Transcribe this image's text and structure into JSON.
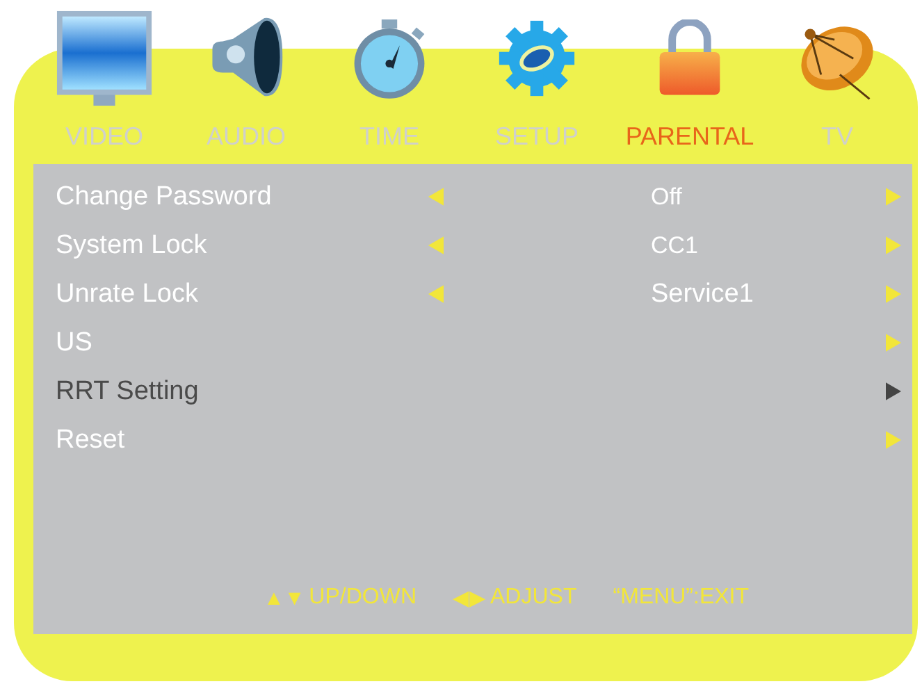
{
  "tabs": [
    {
      "kind": "monitor",
      "label": "VIDEO",
      "selected": false
    },
    {
      "kind": "speaker",
      "label": "AUDIO",
      "selected": false
    },
    {
      "kind": "stopwatch",
      "label": "TIME",
      "selected": false
    },
    {
      "kind": "gear",
      "label": "SETUP",
      "selected": false
    },
    {
      "kind": "padlock",
      "label": "PARENTAL",
      "selected": true
    },
    {
      "kind": "dish",
      "label": "TV",
      "selected": false
    }
  ],
  "rows": [
    {
      "label": "Change Password",
      "adjustable": true,
      "value": "Off",
      "value_disabled": true,
      "selected": false
    },
    {
      "label": "System Lock",
      "adjustable": true,
      "value": "CC1",
      "value_disabled": true,
      "selected": false
    },
    {
      "label": "Unrate Lock",
      "adjustable": true,
      "value": "Service1",
      "value_disabled": false,
      "selected": false
    },
    {
      "label": "US",
      "adjustable": false,
      "selected": false
    },
    {
      "label": "RRT Setting",
      "adjustable": false,
      "selected": true
    },
    {
      "label": "Reset",
      "adjustable": false,
      "selected": false
    }
  ],
  "hints": [
    {
      "keys": "▲▼",
      "label": "UP/DOWN"
    },
    {
      "keys": "◀▶",
      "label": "ADJUST"
    },
    {
      "label": "“MENU”:EXIT"
    }
  ]
}
